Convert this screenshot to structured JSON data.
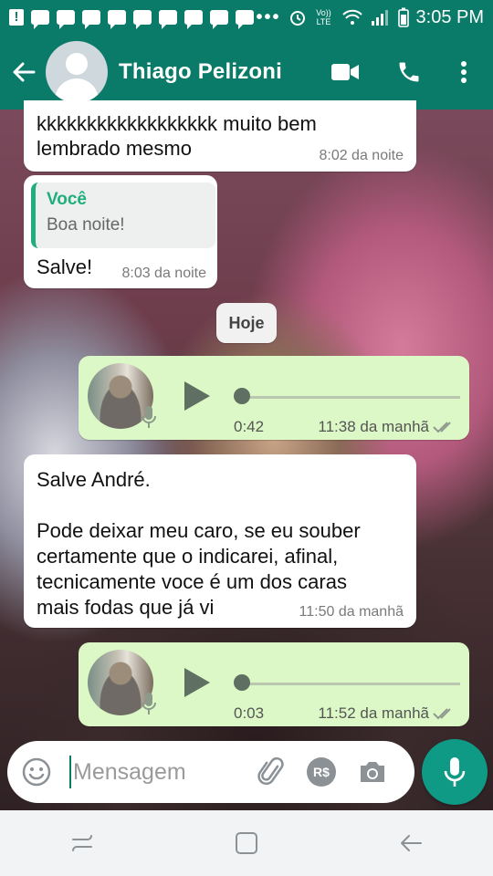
{
  "status_bar": {
    "time": "3:05 PM",
    "network_label": "Vo)) LTE",
    "overflow": "•••"
  },
  "header": {
    "contact_name": "Thiago Pelizoni",
    "icons": [
      "back-arrow-icon",
      "video-call-icon",
      "phone-call-icon",
      "more-vert-icon"
    ]
  },
  "messages": [
    {
      "id": "m1",
      "direction": "incoming",
      "lines": [
        "kkkkkkkkkkkkkkkkkk muito bem",
        "lembrado mesmo"
      ],
      "time": "8:02 da noite"
    },
    {
      "id": "m2",
      "direction": "incoming",
      "quote_author": "Você",
      "quote_text": "Boa noite!",
      "text": "Salve!",
      "time": "8:03 da noite"
    },
    {
      "id": "m3",
      "direction": "outgoing",
      "type": "voice",
      "duration": "0:42",
      "time": "11:38 da manhã"
    },
    {
      "id": "m4",
      "direction": "incoming",
      "line1": "Salve André.",
      "lines": [
        "Pode deixar meu caro, se eu souber",
        "certamente que o indicarei, afinal,",
        "tecnicamente voce é um dos caras",
        "mais fodas que já vi"
      ],
      "time": "11:50 da manhã"
    },
    {
      "id": "m5",
      "direction": "outgoing",
      "type": "voice",
      "duration": "0:03",
      "time": "11:52 da manhã"
    }
  ],
  "date_divider": "Hoje",
  "composer": {
    "placeholder": "Mensagem",
    "currency_label": "R$"
  },
  "colors": {
    "header": "#0b7b69",
    "outgoing_bubble": "#dcf8c6",
    "incoming_bubble": "#ffffff",
    "accent": "#1fae7c"
  }
}
